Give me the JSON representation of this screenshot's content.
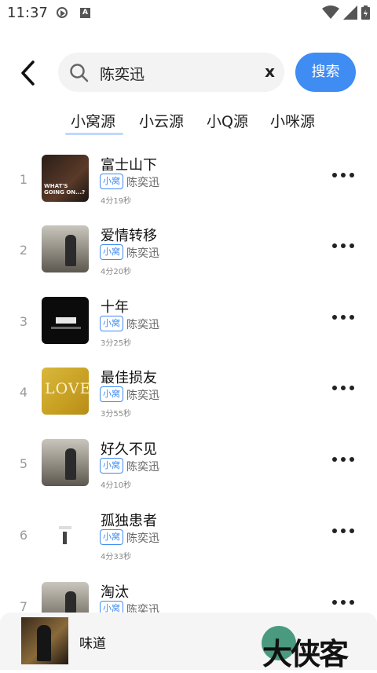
{
  "status_bar": {
    "time": "11:37"
  },
  "search": {
    "query": "陈奕迅",
    "clear_label": "x",
    "button_label": "搜索"
  },
  "tabs": [
    {
      "label": "小窝源",
      "active": true
    },
    {
      "label": "小云源"
    },
    {
      "label": "小Q源"
    },
    {
      "label": "小咪源"
    }
  ],
  "songs": [
    {
      "index": "1",
      "title": "富士山下",
      "source": "小窝",
      "artist": "陈奕迅",
      "duration": "4分19秒",
      "cover_text": "WHAT'S GOING ON...?"
    },
    {
      "index": "2",
      "title": "爱情转移",
      "source": "小窝",
      "artist": "陈奕迅",
      "duration": "4分20秒"
    },
    {
      "index": "3",
      "title": "十年",
      "source": "小窝",
      "artist": "陈奕迅",
      "duration": "3分25秒"
    },
    {
      "index": "4",
      "title": "最佳损友",
      "source": "小窝",
      "artist": "陈奕迅",
      "duration": "3分55秒",
      "cover_text": "LOVE"
    },
    {
      "index": "5",
      "title": "好久不见",
      "source": "小窝",
      "artist": "陈奕迅",
      "duration": "4分10秒"
    },
    {
      "index": "6",
      "title": "孤独患者",
      "source": "小窝",
      "artist": "陈奕迅",
      "duration": "4分33秒"
    },
    {
      "index": "7",
      "title": "淘汰",
      "source": "小窝",
      "artist": "陈奕迅",
      "duration": ""
    }
  ],
  "player": {
    "title": "味道"
  },
  "watermark": {
    "text": "大侠客"
  },
  "colors": {
    "accent": "#3f8cf3",
    "background": "#ffffff",
    "player_bg": "#f5f5f5"
  }
}
